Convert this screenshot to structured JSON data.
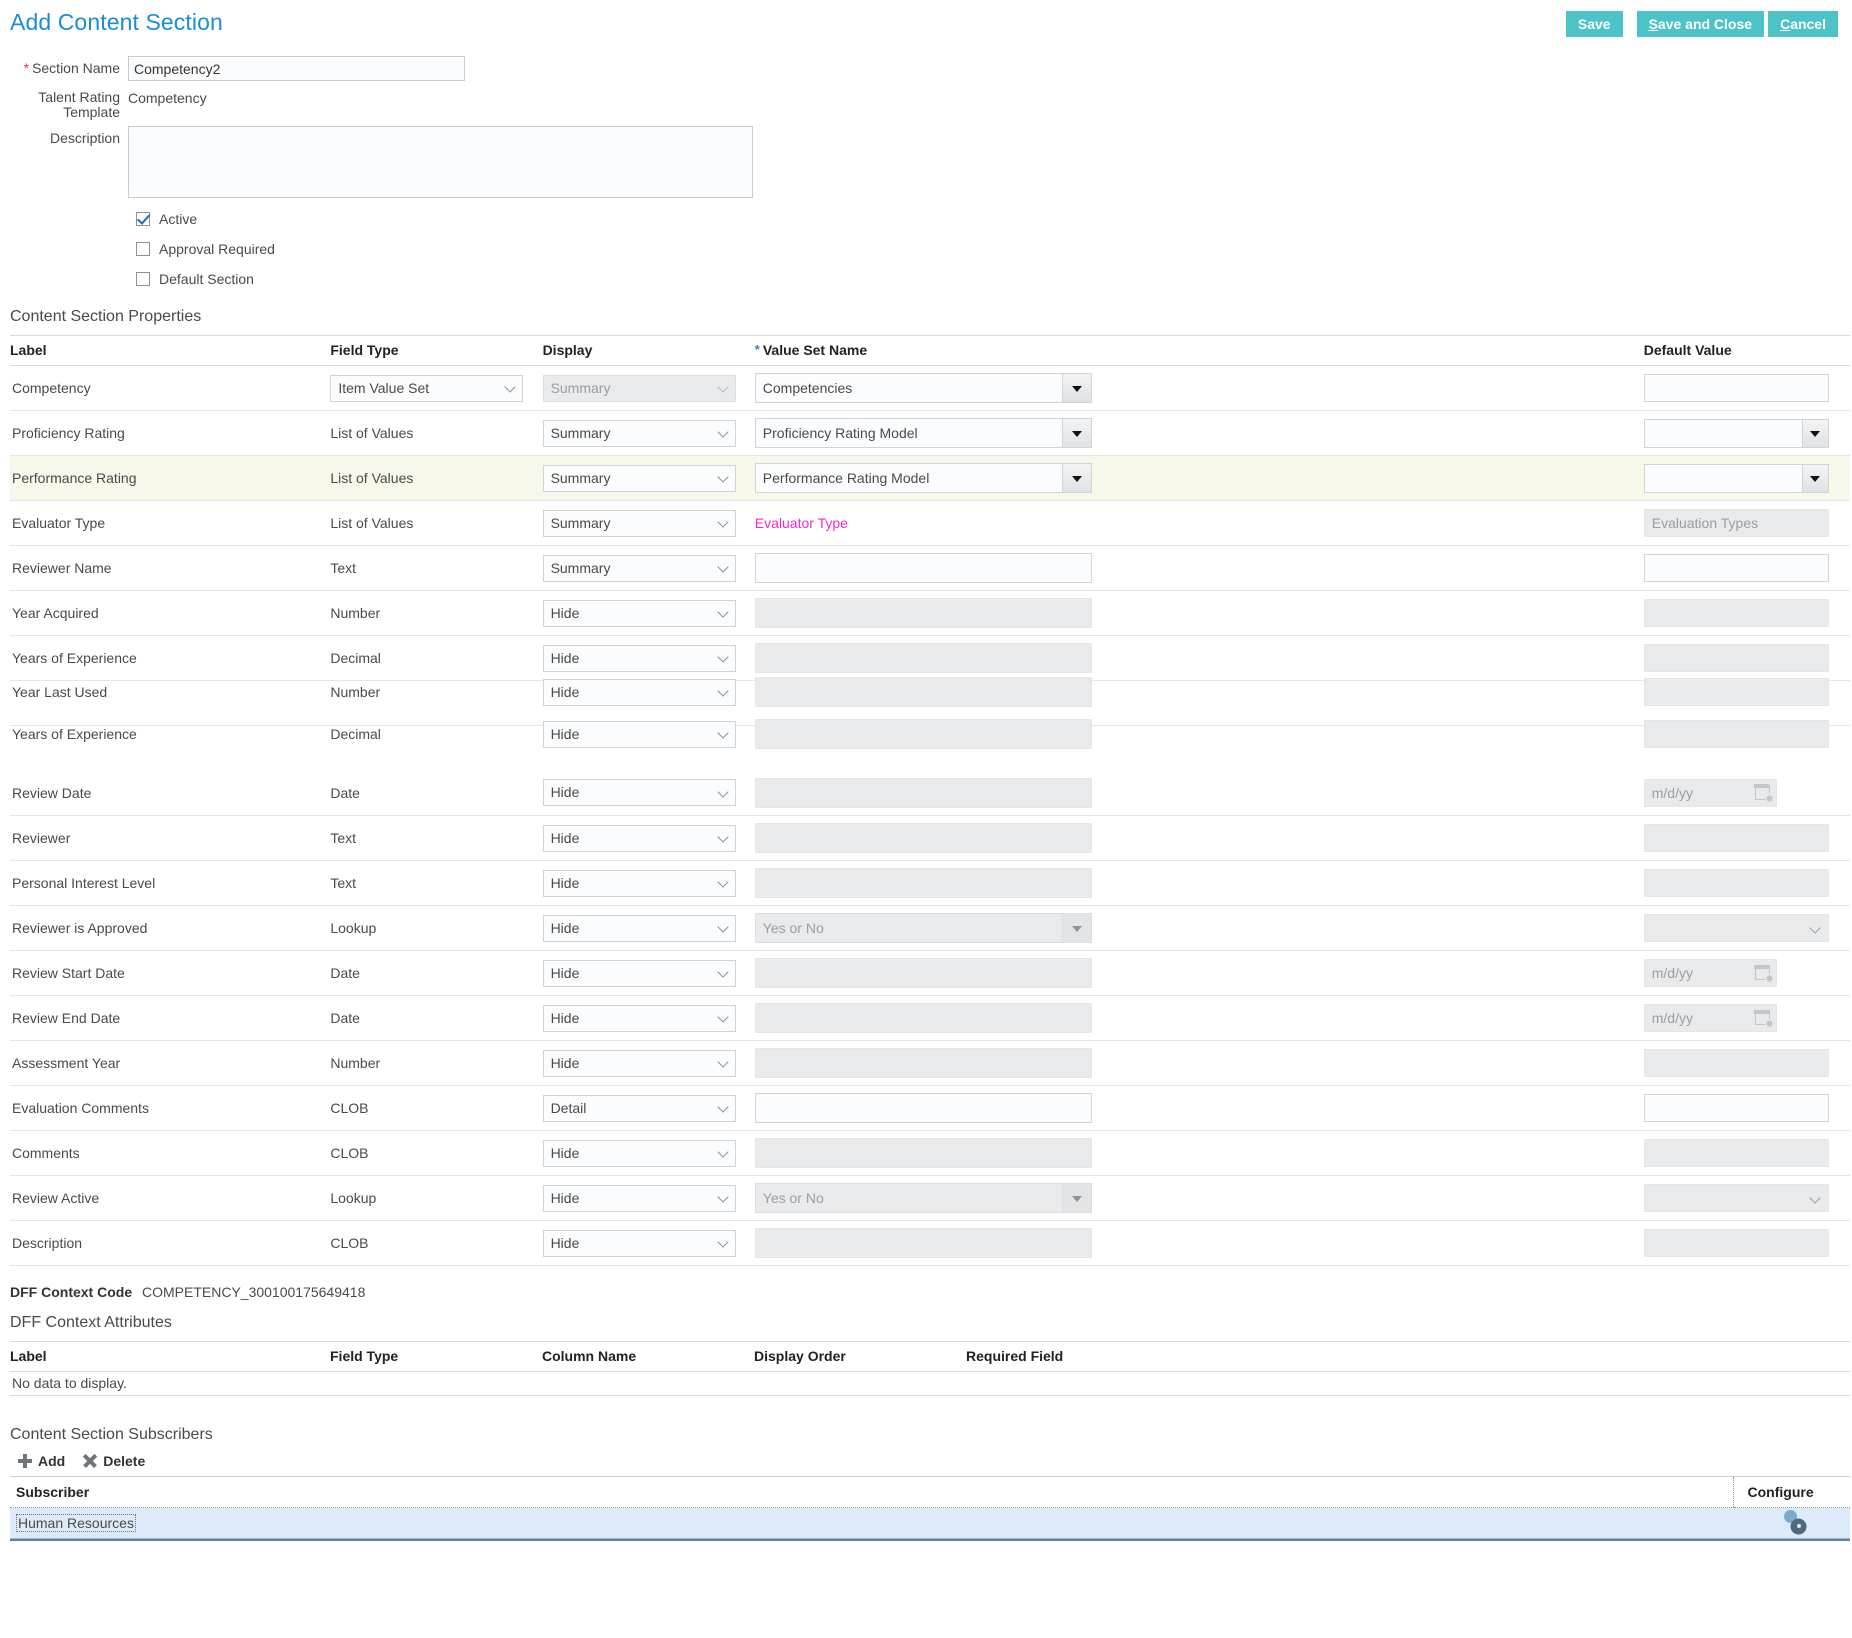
{
  "header": {
    "title": "Add Content Section",
    "buttons": [
      {
        "label": "Save",
        "accel": ""
      },
      {
        "label": "Save and Close",
        "accel": "S"
      },
      {
        "label": "Cancel",
        "accel": "C"
      }
    ],
    "accent_color": "#4ec3c7",
    "title_color": "#1a8cd8"
  },
  "form": {
    "section_name_label": "Section Name",
    "section_name_value": "Competency2",
    "section_name_required": "*",
    "talent_rating_template_label": "Talent Rating Template",
    "talent_rating_template_value": "Competency",
    "description_label": "Description",
    "description_value": "",
    "checkboxes": [
      {
        "label": "Active",
        "checked": true
      },
      {
        "label": "Approval Required",
        "checked": false
      },
      {
        "label": "Default Section",
        "checked": false
      }
    ]
  },
  "properties": {
    "heading": "Content Section Properties",
    "columns": {
      "label": "Label",
      "field_type": "Field Type",
      "display": "Display",
      "value_set_name": "Value Set Name",
      "value_set_required": "*",
      "default_value": "Default Value"
    },
    "rows": [
      {
        "label": "Competency",
        "field_type": "Item Value Set",
        "field_type_widget": "select",
        "display": "Summary",
        "display_disabled": true,
        "vset_kind": "lov",
        "vset_value": "Competencies",
        "vset_disabled": false,
        "dv_kind": "text",
        "dv_value": "",
        "highlight": false
      },
      {
        "label": "Proficiency Rating",
        "field_type": "List of Values",
        "field_type_widget": "text",
        "display": "Summary",
        "display_disabled": false,
        "vset_kind": "lov",
        "vset_value": "Proficiency Rating Model",
        "vset_disabled": false,
        "dv_kind": "lov",
        "dv_value": "",
        "highlight": false
      },
      {
        "label": "Performance Rating",
        "field_type": "List of Values",
        "field_type_widget": "text",
        "display": "Summary",
        "display_disabled": false,
        "vset_kind": "lov",
        "vset_value": "Performance Rating Model",
        "vset_disabled": false,
        "dv_kind": "lov",
        "dv_value": "",
        "highlight": true
      },
      {
        "label": "Evaluator Type",
        "field_type": "List of Values",
        "field_type_widget": "text",
        "display": "Summary",
        "display_disabled": false,
        "vset_kind": "link",
        "vset_value": "Evaluator Type",
        "vset_disabled": false,
        "dv_kind": "text-disabled",
        "dv_value": "Evaluation Types",
        "highlight": false
      },
      {
        "label": "Reviewer Name",
        "field_type": "Text",
        "field_type_widget": "text",
        "display": "Summary",
        "display_disabled": false,
        "vset_kind": "input",
        "vset_value": "",
        "vset_disabled": false,
        "dv_kind": "text",
        "dv_value": "",
        "highlight": false
      },
      {
        "label": "Year Acquired",
        "field_type": "Number",
        "field_type_widget": "text",
        "display": "Hide",
        "display_disabled": false,
        "vset_kind": "input",
        "vset_value": "",
        "vset_disabled": true,
        "dv_kind": "text-disabled",
        "dv_value": "",
        "highlight": false
      },
      {
        "label": "Years of Experience",
        "field_type": "Decimal",
        "field_type_widget": "text",
        "display": "Hide",
        "display_disabled": false,
        "vset_kind": "input",
        "vset_value": "",
        "vset_disabled": true,
        "dv_kind": "text-disabled",
        "dv_value": "",
        "highlight": false
      },
      {
        "label": "Year Last Used",
        "field_type": "Number",
        "field_type_widget": "text",
        "display": "Hide",
        "display_disabled": false,
        "vset_kind": "input",
        "vset_value": "",
        "vset_disabled": true,
        "dv_kind": "text-disabled",
        "dv_value": "",
        "highlight": false,
        "artifact_overlap": true
      },
      {
        "label": "Review Date",
        "field_type": "Date",
        "field_type_widget": "text",
        "display": "Hide",
        "display_disabled": false,
        "vset_kind": "input",
        "vset_value": "",
        "vset_disabled": true,
        "dv_kind": "date",
        "dv_value": "m/d/yy",
        "highlight": false
      },
      {
        "label": "Reviewer",
        "field_type": "Text",
        "field_type_widget": "text",
        "display": "Hide",
        "display_disabled": false,
        "vset_kind": "input",
        "vset_value": "",
        "vset_disabled": true,
        "dv_kind": "text-disabled",
        "dv_value": "",
        "highlight": false
      },
      {
        "label": "Personal Interest Level",
        "field_type": "Text",
        "field_type_widget": "text",
        "display": "Hide",
        "display_disabled": false,
        "vset_kind": "input",
        "vset_value": "",
        "vset_disabled": true,
        "dv_kind": "text-disabled",
        "dv_value": "",
        "highlight": false
      },
      {
        "label": "Reviewer is Approved",
        "field_type": "Lookup",
        "field_type_widget": "text",
        "display": "Hide",
        "display_disabled": false,
        "vset_kind": "lov",
        "vset_value": "Yes or No",
        "vset_disabled": true,
        "dv_kind": "select-disabled",
        "dv_value": "",
        "highlight": false
      },
      {
        "label": "Review Start Date",
        "field_type": "Date",
        "field_type_widget": "text",
        "display": "Hide",
        "display_disabled": false,
        "vset_kind": "input",
        "vset_value": "",
        "vset_disabled": true,
        "dv_kind": "date",
        "dv_value": "m/d/yy",
        "highlight": false
      },
      {
        "label": "Review End Date",
        "field_type": "Date",
        "field_type_widget": "text",
        "display": "Hide",
        "display_disabled": false,
        "vset_kind": "input",
        "vset_value": "",
        "vset_disabled": true,
        "dv_kind": "date",
        "dv_value": "m/d/yy",
        "highlight": false
      },
      {
        "label": "Assessment Year",
        "field_type": "Number",
        "field_type_widget": "text",
        "display": "Hide",
        "display_disabled": false,
        "vset_kind": "input",
        "vset_value": "",
        "vset_disabled": true,
        "dv_kind": "text-disabled",
        "dv_value": "",
        "highlight": false
      },
      {
        "label": "Evaluation Comments",
        "field_type": "CLOB",
        "field_type_widget": "text",
        "display": "Detail",
        "display_disabled": false,
        "vset_kind": "input",
        "vset_value": "",
        "vset_disabled": false,
        "dv_kind": "text",
        "dv_value": "",
        "highlight": false
      },
      {
        "label": "Comments",
        "field_type": "CLOB",
        "field_type_widget": "text",
        "display": "Hide",
        "display_disabled": false,
        "vset_kind": "input",
        "vset_value": "",
        "vset_disabled": true,
        "dv_kind": "text-disabled",
        "dv_value": "",
        "highlight": false
      },
      {
        "label": "Review Active",
        "field_type": "Lookup",
        "field_type_widget": "text",
        "display": "Hide",
        "display_disabled": false,
        "vset_kind": "lov",
        "vset_value": "Yes or No",
        "vset_disabled": true,
        "dv_kind": "select-disabled",
        "dv_value": "",
        "highlight": false
      },
      {
        "label": "Description",
        "field_type": "CLOB",
        "field_type_widget": "text",
        "display": "Hide",
        "display_disabled": false,
        "vset_kind": "input",
        "vset_value": "",
        "vset_disabled": true,
        "dv_kind": "text-disabled",
        "dv_value": "",
        "highlight": false
      }
    ],
    "artifact_row": {
      "label": "Years of Experience",
      "field_type": "Decimal",
      "display": "Hide"
    }
  },
  "dff": {
    "context_code_label": "DFF Context Code",
    "context_code_value": "COMPETENCY_300100175649418",
    "attributes_heading": "DFF Context Attributes",
    "columns": [
      "Label",
      "Field Type",
      "Column Name",
      "Display Order",
      "Required Field"
    ],
    "no_data": "No data to display."
  },
  "subscribers": {
    "heading": "Content Section Subscribers",
    "toolbar": [
      {
        "label": "Add",
        "icon": "plus-icon"
      },
      {
        "label": "Delete",
        "icon": "x-icon"
      }
    ],
    "columns": {
      "subscriber": "Subscriber",
      "configure": "Configure"
    },
    "rows": [
      {
        "subscriber": "Human Resources",
        "configure_icon": "gear-icon"
      }
    ]
  }
}
